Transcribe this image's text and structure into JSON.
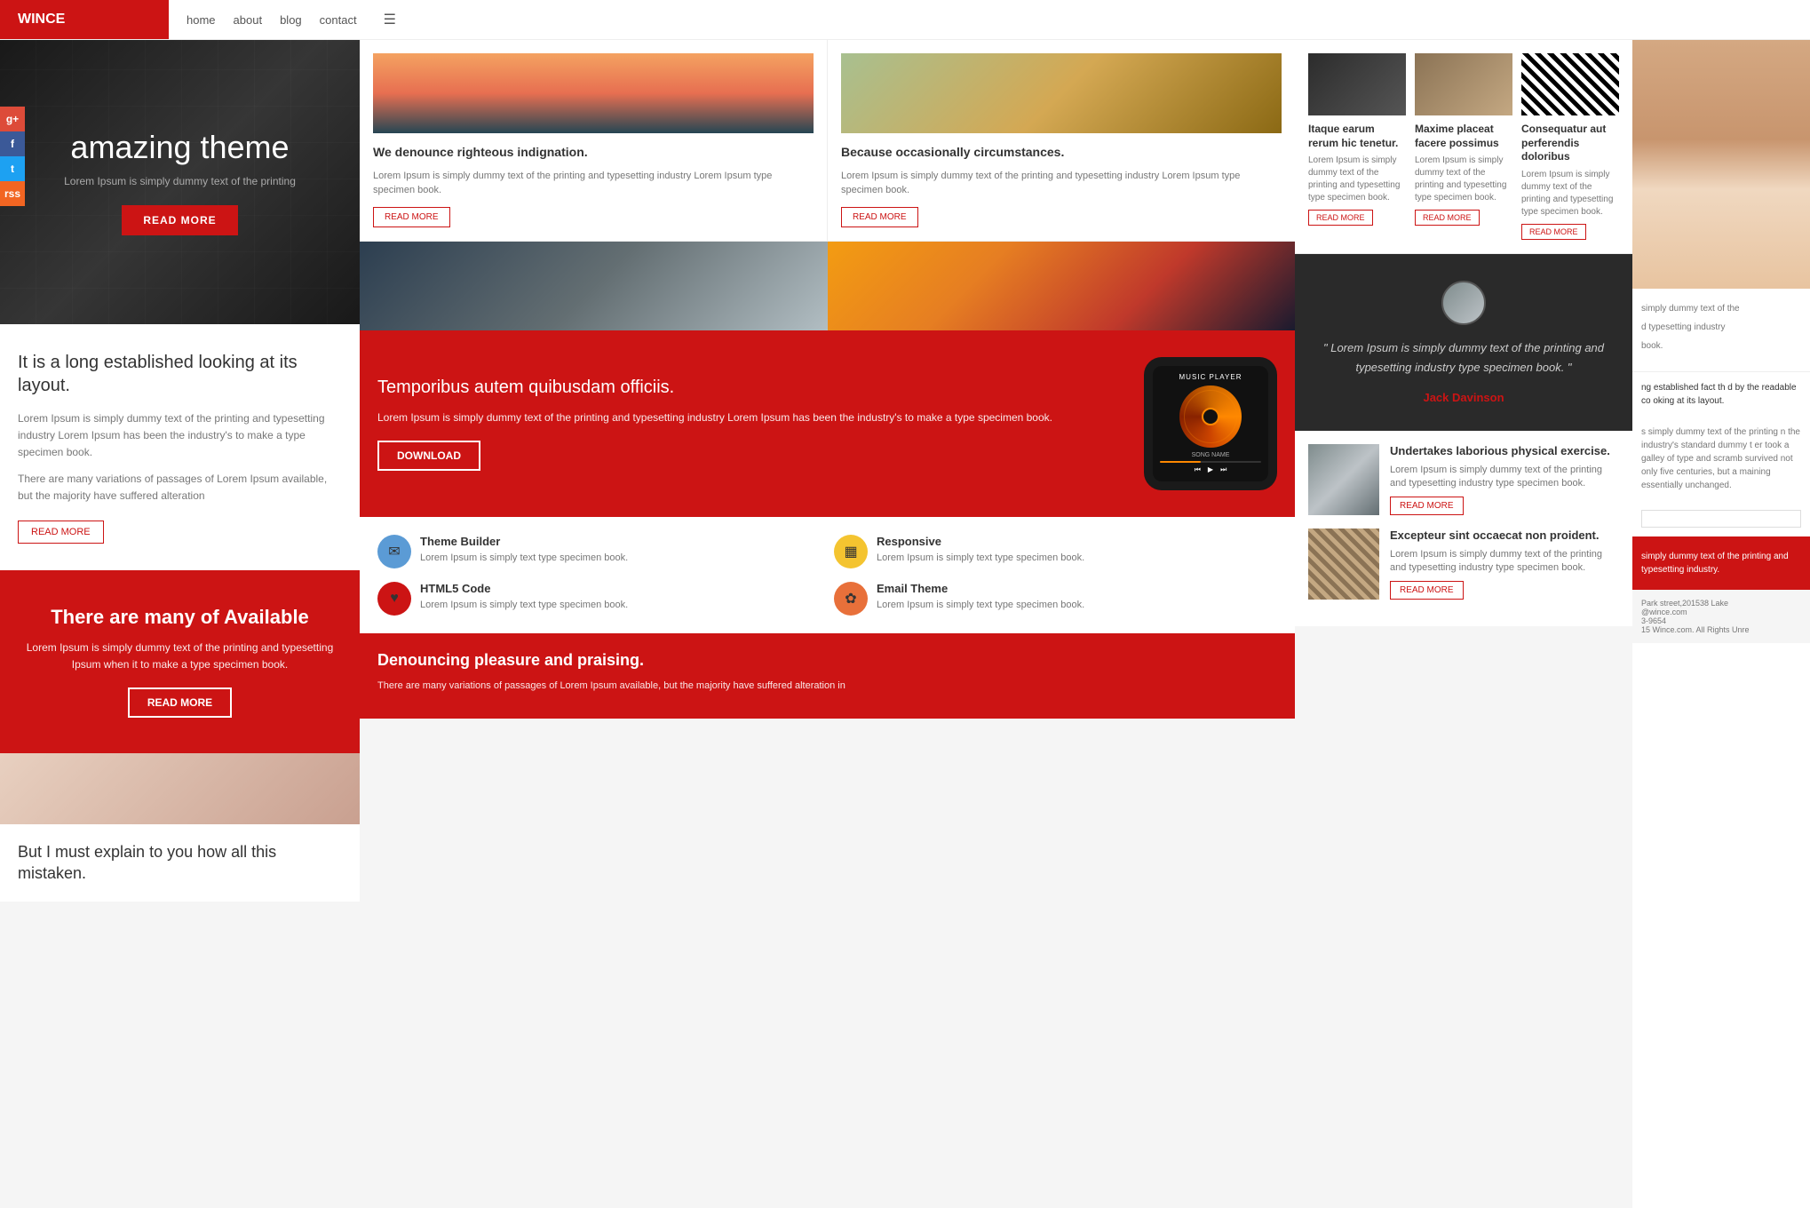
{
  "header": {
    "logo": "WINCE",
    "nav": {
      "home": "home",
      "about": "about",
      "blog": "blog",
      "contact": "contact"
    }
  },
  "social": {
    "gplus": "g+",
    "facebook": "f",
    "twitter": "t",
    "rss": "rss"
  },
  "hero": {
    "title": "amazing theme",
    "subtitle": "Lorem Ipsum is simply dummy text of the printing",
    "btn": "READ MORE"
  },
  "below_hero": {
    "title": "It is a long established looking at its layout.",
    "para1": "Lorem Ipsum is simply dummy text of the printing and typesetting industry Lorem Ipsum has been the industry's to make a type specimen book.",
    "para2": "There are many variations of passages of Lorem Ipsum available, but the majority have suffered alteration",
    "btn": "READ MORE"
  },
  "red_section": {
    "title": "There are many of Available",
    "para": "Lorem Ipsum is simply dummy text of the printing and typesetting Ipsum when it to make a type specimen book.",
    "btn": "READ MORE"
  },
  "cards": [
    {
      "title": "We denounce righteous indignation.",
      "para": "Lorem Ipsum is simply dummy text of the printing and typesetting industry Lorem Ipsum type specimen book.",
      "btn": "READ MORE",
      "img_type": "sunset"
    },
    {
      "title": "Because occasionally circumstances.",
      "para": "Lorem Ipsum is simply dummy text of the printing and typesetting industry Lorem Ipsum type specimen book.",
      "btn": "READ MORE",
      "img_type": "field"
    }
  ],
  "music_section": {
    "title": "Temporibus autem quibusdam officiis.",
    "para": "Lorem Ipsum is simply dummy text of the printing and typesetting industry Lorem Ipsum has been the industry's to make a type specimen book.",
    "btn": "DOWNLOAD",
    "phone_title": "MUSIC PLAYER",
    "song_name": "SONG NAME"
  },
  "features": [
    {
      "icon": "✉",
      "icon_color": "blue",
      "title": "Theme Builder",
      "para": "Lorem Ipsum is simply text type specimen book."
    },
    {
      "icon": "▦",
      "icon_color": "yellow",
      "title": "Responsive",
      "para": "Lorem Ipsum is simply text type specimen book."
    },
    {
      "icon": "♥",
      "icon_color": "red",
      "title": "HTML5 Code",
      "para": "Lorem Ipsum is simply text type specimen book."
    },
    {
      "icon": "✿",
      "icon_color": "orange",
      "title": "Email Theme",
      "para": "Lorem Ipsum is simply text type specimen book."
    }
  ],
  "bottom_middle": {
    "title": "Denouncing pleasure and praising.",
    "para": "There are many variations of passages of Lorem Ipsum available, but the majority have suffered alteration in"
  },
  "mini_cards": [
    {
      "title": "Itaque earum rerum hic tenetur.",
      "para": "Lorem Ipsum is simply dummy text of the printing and typesetting type specimen book.",
      "btn": "READ MORE",
      "img_type": "dark"
    },
    {
      "title": "Maxime placeat facere possimus",
      "para": "Lorem Ipsum is simply dummy text of the printing and typesetting type specimen book.",
      "btn": "READ MORE",
      "img_type": "desk"
    },
    {
      "title": "Consequatur aut perferendis doloribus",
      "para": "Lorem Ipsum is simply dummy text of the printing and typesetting type specimen book.",
      "btn": "READ MORE",
      "img_type": "zebra"
    }
  ],
  "testimonial": {
    "quote": "\" Lorem Ipsum is simply dummy text of the printing and typesetting industry type specimen book. \"",
    "author": "Jack Davinson"
  },
  "blog_posts": [
    {
      "title": "Undertakes laborious physical exercise.",
      "para": "Lorem Ipsum is simply dummy text of the printing and typesetting industry type specimen book.",
      "btn": "READ MORE",
      "img_type": "rocks"
    },
    {
      "title": "Excepteur sint occaecat non proident.",
      "para": "Lorem Ipsum is simply dummy text of the printing and typesetting industry type specimen book.",
      "btn": "READ MORE",
      "img_type": "rope"
    }
  ],
  "far_right": {
    "text1": "simply dummy text of the",
    "text2": "d typesetting industry",
    "text3": "book.",
    "long_text": "ng established fact th d by the readable co oking at its layout.",
    "para": "s simply dummy text of the printing n the industry's standard dummy t er took a galley of type and scramb survived not only five centuries, but a maining essentially unchanged.",
    "red_para": "simply dummy text of the printing and typesetting industry.",
    "footer_addr": "Park street,201538 Lake",
    "footer_email": "@wince.com",
    "footer_phone": "3-9654",
    "footer_copy": "15 Wince.com. All Rights Unre"
  },
  "bottom_text": {
    "title": "But I must explain to you how all this mistaken."
  },
  "colors": {
    "primary_red": "#cc1414",
    "dark": "#1a1a1a",
    "text_gray": "#777"
  }
}
